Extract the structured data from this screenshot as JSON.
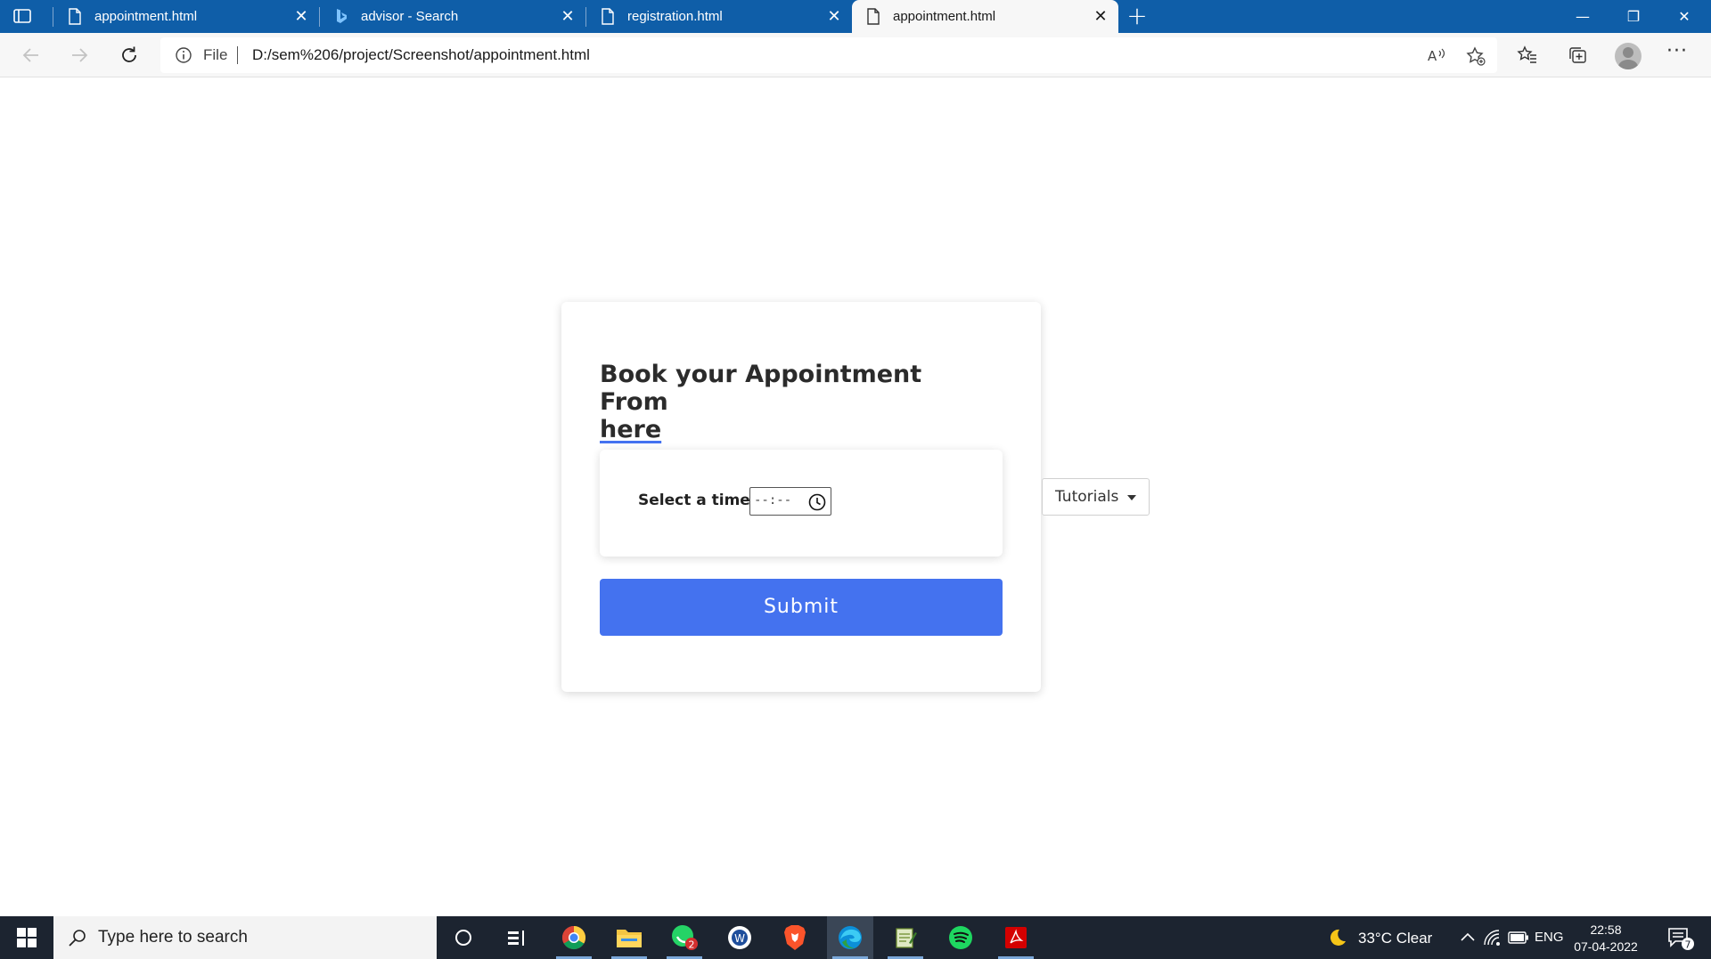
{
  "browser": {
    "tabs": [
      {
        "title": "appointment.html",
        "icon": "page-icon",
        "close": "✕"
      },
      {
        "title": "advisor - Search",
        "icon": "bing-icon",
        "close": "✕"
      },
      {
        "title": "registration.html",
        "icon": "page-icon",
        "close": "✕"
      },
      {
        "title": "appointment.html",
        "icon": "page-icon",
        "close": "✕",
        "active": true
      }
    ],
    "new_tab": "+",
    "window_controls": {
      "minimize": "—",
      "restore": "❐",
      "close": "✕"
    },
    "address": {
      "scheme_label": "File",
      "url": "D:/sem%206/project/Screenshot/appointment.html"
    },
    "more": "···"
  },
  "page": {
    "title_line1": "Book your Appointment From",
    "title_line2": "here",
    "time_label": "Select a time:",
    "time_value": "--:--",
    "submit_label": "Submit",
    "dropdown_label": "Tutorials"
  },
  "taskbar": {
    "search_placeholder": "Type here to search",
    "weather": "33°C  Clear",
    "language": "ENG",
    "time": "22:58",
    "date": "07-04-2022",
    "whatsapp_badge": "2",
    "notifications_badge": "7"
  },
  "colors": {
    "tabstrip": "#0f5ea8",
    "accent_button": "#4472ef",
    "taskbar": "#1c2430"
  }
}
